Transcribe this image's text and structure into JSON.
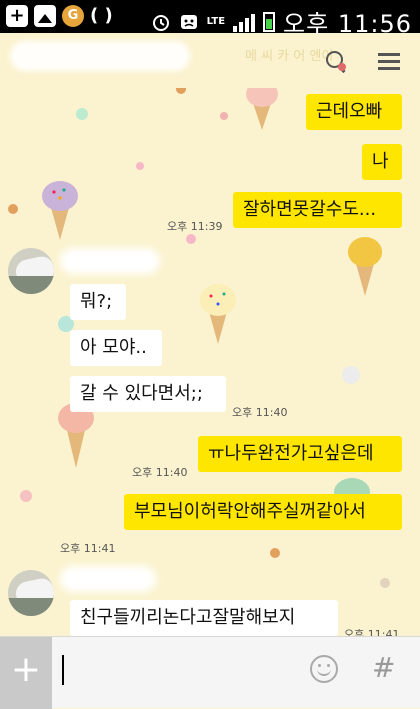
{
  "status_bar": {
    "time": "오후 11:56",
    "network": "LTE",
    "icons": [
      "plus-icon",
      "image-icon",
      "coin-icon",
      "bracket-icon",
      "alarm-icon",
      "notification-icon",
      "signal-icon",
      "battery-icon"
    ]
  },
  "header": {
    "faint_text": "메  씨 카  어 엔이",
    "search_icon": "search-icon",
    "menu_icon": "menu-icon"
  },
  "messages": [
    {
      "side": "mine",
      "text": "근데오빠",
      "time": ""
    },
    {
      "side": "mine",
      "text": "나",
      "time": ""
    },
    {
      "side": "mine",
      "text": "잘하면못갈수도...",
      "time": "오후 11:39"
    },
    {
      "side": "theirs",
      "text": "뭐?;",
      "time": ""
    },
    {
      "side": "theirs",
      "text": "아 모야..",
      "time": ""
    },
    {
      "side": "theirs",
      "text": "갈 수 있다면서;;",
      "time": "오후 11:40"
    },
    {
      "side": "mine",
      "text": "ㅠ나두완전가고싶은데",
      "time": "오후 11:40"
    },
    {
      "side": "mine",
      "text": "부모님이허락안해주실꺼같아서",
      "time": "오후 11:41"
    },
    {
      "side": "theirs",
      "text": "친구들끼리논다고잘말해보지",
      "time": "오후 11:41"
    }
  ],
  "input_bar": {
    "plus_label": "+",
    "input_value": "",
    "hash_label": "#"
  },
  "colors": {
    "background": "#fbf3cf",
    "my_bubble": "#ffe600",
    "their_bubble": "#ffffff",
    "status_bar": "#000000"
  }
}
